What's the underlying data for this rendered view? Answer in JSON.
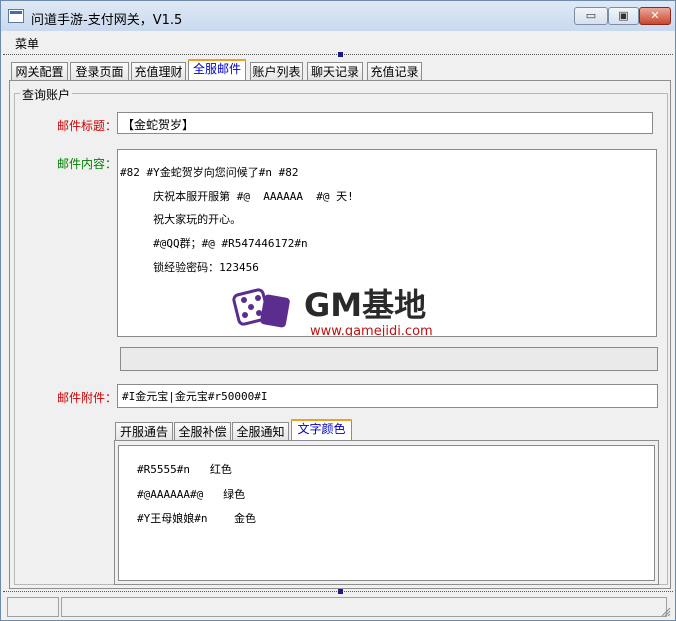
{
  "window": {
    "title": "问道手游-支付网关，V1.5"
  },
  "titlebar_buttons": {
    "minimize": "▭",
    "restore": "▣",
    "close": "✕"
  },
  "menu": {
    "label": "菜单"
  },
  "main_tabs": [
    "网关配置",
    "登录页面",
    "充值理财",
    "全服邮件",
    "账户列表",
    "聊天记录",
    "充值记录"
  ],
  "active_tab": "全服邮件",
  "group": {
    "title": "查询账户"
  },
  "mail": {
    "subject_label": "邮件标题：",
    "subject_value": "【金蛇贺岁】",
    "content_label": "邮件内容：",
    "content_lines": [
      "#82 #Y金蛇贺岁向您问候了#n #82",
      "     庆祝本服开服第 #@  AAAAAA  #@ 天!",
      "     祝大家玩的开心。",
      "     #@QQ群；#@ #R547446172#n",
      "     锁经验密码：123456"
    ],
    "attachment_label": "邮件附件：",
    "attachment_value": "#I金元宝|金元宝#r50000#I"
  },
  "sub_tabs": [
    "开服通告",
    "全服补偿",
    "全服通知",
    "文字颜色"
  ],
  "active_sub_tab": "文字颜色",
  "color_lines": [
    "#R5555#n   红色",
    "#@AAAAAA#@   绿色",
    "#Y王母娘娘#n    金色"
  ],
  "watermark": {
    "brand": "GM基地",
    "url": "www.gamejidi.com"
  },
  "colors": {
    "label_red": "#cc0000",
    "label_green": "#008000",
    "tab_active_text": "#0000cc",
    "dice_purple": "#5b2d8e"
  }
}
